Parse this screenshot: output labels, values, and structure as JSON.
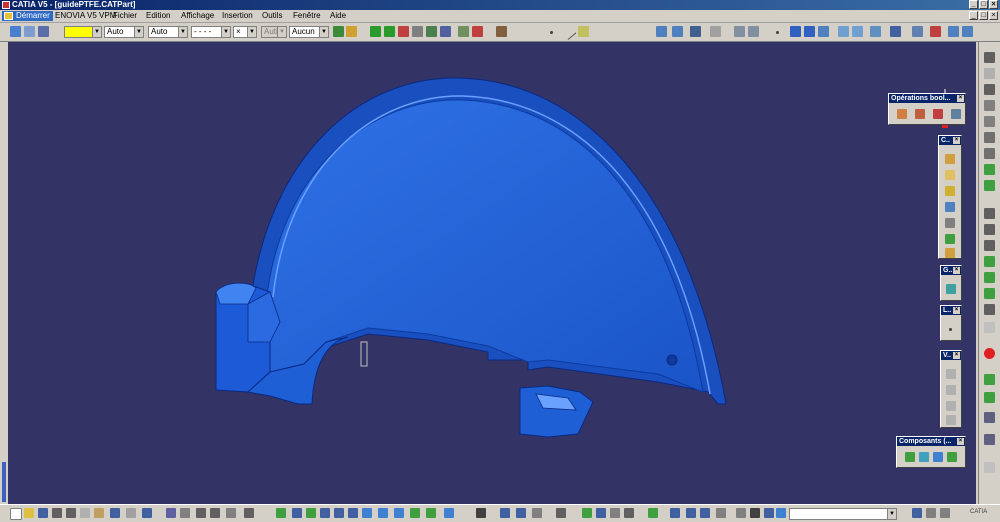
{
  "window": {
    "title": "CATIA V5 - [guidePTFE.CATPart]",
    "min": "_",
    "max": "□",
    "close": "×"
  },
  "menu": {
    "start": "Démarrer",
    "items": [
      "ENOVIA V5 VPM",
      "Fichier",
      "Edition",
      "Affichage",
      "Insertion",
      "Outils",
      "Fenêtre",
      "Aide"
    ]
  },
  "toolbar": {
    "color_value": "",
    "transparency": "Auto",
    "line_weight": "Auto",
    "line_type": "- - - -",
    "point_type": "×",
    "layer_disabled": "Auti",
    "render_style": "Aucun"
  },
  "panels": {
    "boolean": {
      "title": "Opérations bool...",
      "close": "×"
    },
    "c": {
      "title": "C..",
      "close": "×"
    },
    "g": {
      "title": "G..",
      "close": "×"
    },
    "l": {
      "title": "L..",
      "close": "×"
    },
    "v": {
      "title": "V..",
      "close": "×"
    },
    "components": {
      "title": "Composants (...",
      "close": "×"
    }
  },
  "bottom": {
    "command_value": "",
    "catia_label": "CATIA"
  },
  "viewport": {
    "background": "#333366",
    "part_color": "#1f5fd6",
    "axes": "x"
  },
  "colors": {
    "accent": "#0a246a",
    "selection": "#316ac5"
  }
}
